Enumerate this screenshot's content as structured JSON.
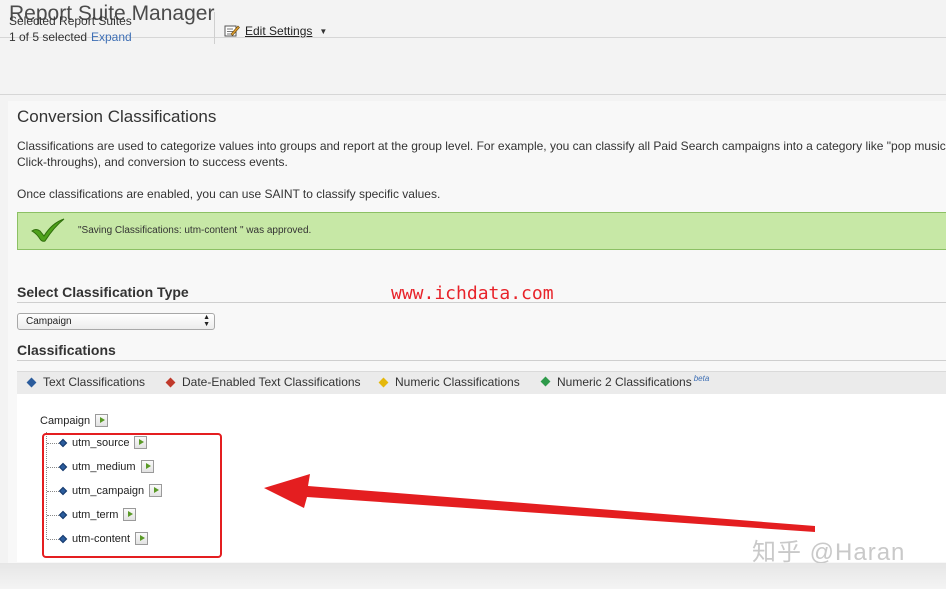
{
  "app": {
    "title": "Report Suite Manager"
  },
  "toolbar": {
    "selected_label": "Selected Report Suites",
    "selected_count": "1 of 5 selected",
    "expand_label": "Expand",
    "edit_settings_label": "Edit Settings"
  },
  "main": {
    "title": "Conversion Classifications",
    "desc_line1": "Classifications are used to categorize values into groups and report at the group level. For example, you can classify all Paid Search campaigns into a category like \"pop music term",
    "desc_line2": "Click-throughs), and conversion to success events.",
    "desc_line3": "Once classifications are enabled, you can use SAINT to classify specific values.",
    "success_message": "\"Saving Classifications: utm-content \" was approved.",
    "select_type_heading": "Select Classification Type",
    "select_value": "Campaign",
    "classifications_heading": "Classifications"
  },
  "legend": [
    {
      "label": "Text Classifications",
      "color": "#2b5c9c"
    },
    {
      "label": "Date-Enabled Text Classifications",
      "color": "#c0392b"
    },
    {
      "label": "Numeric Classifications",
      "color": "#e5b80b"
    },
    {
      "label": "Numeric 2 Classifications",
      "color": "#2e9a4a",
      "badge": "beta"
    }
  ],
  "tree": {
    "root": "Campaign",
    "children": [
      "utm_source",
      "utm_medium",
      "utm_campaign",
      "utm_term",
      "utm-content"
    ]
  },
  "watermarks": {
    "site": "www.ichdata.com",
    "author": "知乎 @Haran"
  },
  "colors": {
    "banner_bg": "#c7e8a6",
    "annotation_red": "#e41e20",
    "link": "#3e6fb5"
  }
}
